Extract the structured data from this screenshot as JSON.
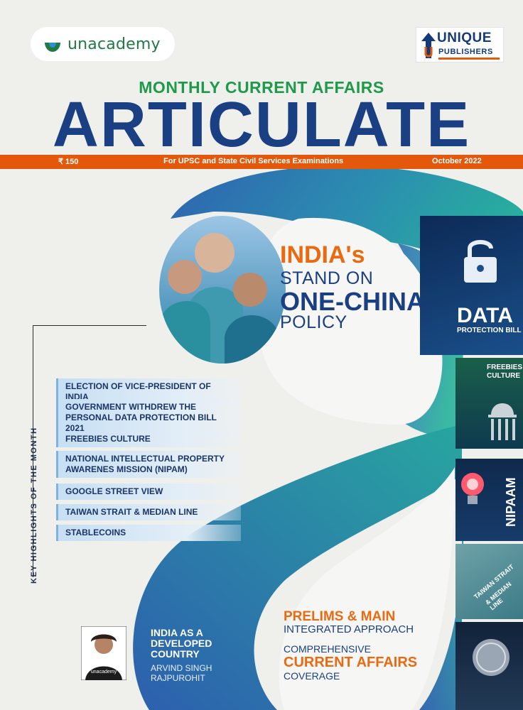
{
  "logos": {
    "left_brand": "unacademy",
    "right_brand_line1": "UNIQUE",
    "right_brand_line2": "PUBLISHERS"
  },
  "masthead": {
    "kicker": "MONTHLY CURRENT AFFAIRS",
    "title": "ARTICULATE"
  },
  "band": {
    "price": "₹ 150",
    "tagline": "For UPSC and State Civil Services Examinations",
    "issue": "October 2022"
  },
  "cover_story": {
    "line1": "INDIA's",
    "line2": "STAND ON",
    "line3": "ONE-CHINA",
    "line4": "POLICY"
  },
  "side_tiles": {
    "data_big": "DATA",
    "data_small": "PROTECTION BILL",
    "freebies_1": "FREEBIES",
    "freebies_2": "CULTURE",
    "nipaam": "NIPAAM",
    "taiwan_1": "TAIWAN STRAIT",
    "taiwan_2": "& MEDIAN LINE"
  },
  "highlights": {
    "label": "KEY HIGHLIGHTS OF THE MONTH",
    "items": [
      "ELECTION OF VICE-PRESIDENT OF INDIA",
      "GOVERNMENT WITHDREW THE PERSONAL DATA PROTECTION BILL 2021",
      "FREEBIES CULTURE",
      "NATIONAL INTELLECTUAL PROPERTY AWARENES MISSION (NIPAM)",
      "GOOGLE STREET VIEW",
      "TAIWAN STRAIT & MEDIAN LINE",
      "STABLECOINS"
    ]
  },
  "author": {
    "title_line1": "INDIA AS A",
    "title_line2": "DEVELOPED",
    "title_line3": "COUNTRY",
    "name_line1": "ARVIND SINGH",
    "name_line2": "RAJPUROHIT",
    "shirt_text": "unacademy"
  },
  "promo": {
    "line1": "PRELIMS & MAIN",
    "line2": "INTEGRATED APPROACH",
    "line3": "COMPREHENSIVE",
    "line4": "CURRENT AFFAIRS",
    "line5": "COVERAGE"
  },
  "colors": {
    "navy": "#1a3f82",
    "orange": "#e4580c",
    "green": "#1e9a4a",
    "teal": "#2aa79a",
    "blue": "#2f6fb5"
  }
}
